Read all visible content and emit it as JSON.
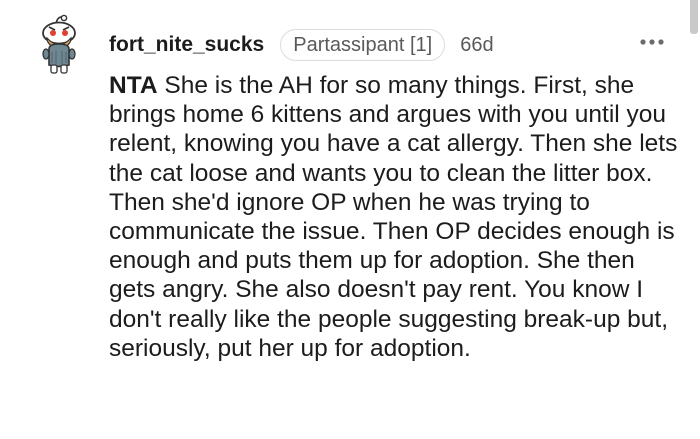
{
  "comment": {
    "author": "fort_nite_sucks",
    "flair": "Partassipant [1]",
    "age": "66d",
    "verdict": "NTA",
    "text": "She is the AH for so many things. First, she brings home 6 kittens and argues with you until you relent, knowing you have a cat allergy. Then she lets the cat loose and wants you to clean the litter box. Then she'd ignore OP when he was trying to communicate the issue. Then OP decides enough is enough and puts them up for adoption. She then gets angry. She also doesn't pay rent. You know I don't really like the people suggesting break-up but, seriously, put her up for adoption.",
    "avatar_icon": "snoo-avatar-icon",
    "more_icon": "more-options-icon"
  },
  "colors": {
    "text": "#1c1c1c",
    "meta": "#5a5a5a",
    "flair_border": "#dcdcdc",
    "background": "#ffffff"
  }
}
